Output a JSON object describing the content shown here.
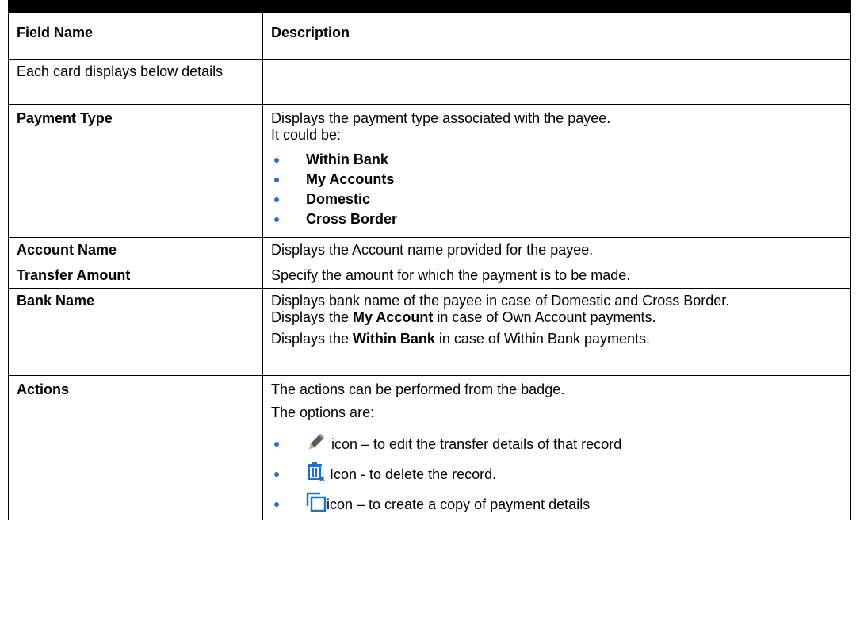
{
  "table": {
    "headers": {
      "field": "Field Name",
      "description": "Description"
    },
    "rows": {
      "each_card": {
        "field": "Each card displays below details"
      },
      "payment_type": {
        "field": "Payment Type",
        "line1": "Displays the payment type associated with the payee.",
        "line2": "It could be:",
        "options": [
          "Within Bank",
          "My Accounts",
          "Domestic",
          "Cross Border"
        ]
      },
      "account_name": {
        "field": "Account Name",
        "desc": "Displays the Account name provided for the payee."
      },
      "transfer_amount": {
        "field": "Transfer Amount",
        "desc": "Specify the amount for which the payment is to be made."
      },
      "bank_name": {
        "field": "Bank Name",
        "line1": "Displays bank name of the payee in case of Domestic and Cross Border.",
        "line2_pre": "Displays the ",
        "line2_bold": "My Account",
        "line2_post": " in case of Own Account payments.",
        "line3_pre": "Displays the ",
        "line3_bold": "Within Bank",
        "line3_post": " in case of Within Bank payments."
      },
      "actions": {
        "field": "Actions",
        "line1": "The actions can be performed from the badge.",
        "line2": "The options are:",
        "items": [
          {
            "icon": "pencil-icon",
            "text": "icon – to edit the transfer details of that record"
          },
          {
            "icon": "trash-icon",
            "text": "Icon - to delete the record."
          },
          {
            "icon": "copy-icon",
            "text": "icon – to create a copy of payment details"
          }
        ]
      }
    }
  },
  "colors": {
    "bullet": "#2b6fc2",
    "icon_blue": "#1a73c8"
  }
}
